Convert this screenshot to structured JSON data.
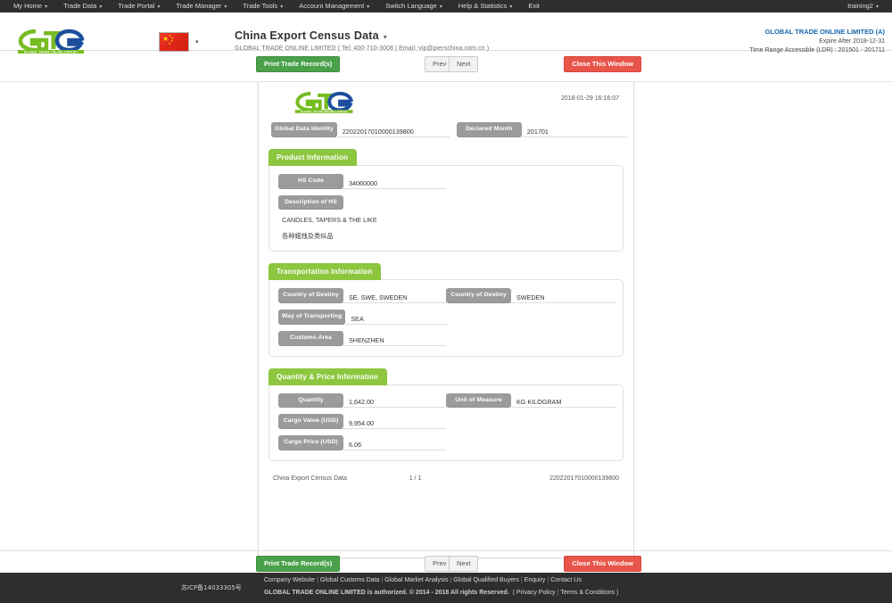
{
  "topnav": {
    "items": [
      {
        "label": "My Home",
        "caret": true
      },
      {
        "label": "Trade Data",
        "caret": true
      },
      {
        "label": "Trade Portal",
        "caret": true
      },
      {
        "label": "Trade Manager",
        "caret": true
      },
      {
        "label": "Trade Tools",
        "caret": true
      },
      {
        "label": "Account Management",
        "caret": true
      },
      {
        "label": "Switch Language",
        "caret": true
      },
      {
        "label": "Help & Statistics",
        "caret": true
      },
      {
        "label": "Exit",
        "caret": false
      }
    ],
    "user": "training2",
    "user_caret": "▾"
  },
  "header": {
    "logo_text": "GTO",
    "logo_tagline": "GLOBAL TRADE ONLINE LIMITED",
    "flag": "china-flag",
    "flag_caret": "▾",
    "title": "China Export Census Data",
    "title_caret": "▾",
    "subtitle": "GLOBAL TRADE ONLINE LIMITED ( Tel: 400-710-3008 | Email: vip@pierschina.com.cn )",
    "account_name": "GLOBAL TRADE ONLINE LIMITED (A)",
    "expire": "Expire After 2018-12-31",
    "time_range": "Time Range Accessible (LDR) : 201501 - 201711"
  },
  "toolbar": {
    "print_label": "Print Trade Record(s)",
    "prev_label": "Prev",
    "next_label": "Next",
    "close_label": "Close This Window"
  },
  "document": {
    "logo_text": "GTO",
    "logo_tagline": "GLOBAL TRADE ONLINE LIMITED",
    "timestamp": "2018-01-29 16:16:07",
    "identity_label": "Global Data Identity",
    "identity_value": "22022017010000139800",
    "declared_month_label": "Declared Month",
    "declared_month_value": "201701",
    "sections": [
      {
        "title": "Product Information",
        "fields": [
          {
            "label": "HS Code",
            "value": "34060000"
          },
          {
            "label": "Description of HS",
            "value": ""
          }
        ],
        "description_en": "CANDLES, TAPERS & THE LIKE",
        "description_cn": "各种蜡烛及类似品"
      },
      {
        "title": "Transportation Information",
        "rows": [
          {
            "label": "Country of Destiny",
            "value": "SE, SWE, SWEDEN",
            "label2": "Country of Destiny",
            "value2": "SWEDEN"
          },
          {
            "label": "Way of Transporting",
            "value": "SEA"
          },
          {
            "label": "Customs Area",
            "value": "SHENZHEN"
          }
        ]
      },
      {
        "title": "Quantity & Price Information",
        "rows": [
          {
            "label": "Quantity",
            "value": "1,642.00",
            "label2": "Unit of Measure",
            "value2": "KG KILOGRAM"
          },
          {
            "label": "Cargo Value (USD)",
            "value": "9,954.00"
          },
          {
            "label": "Cargo Price (USD)",
            "value": "6.06"
          }
        ]
      }
    ],
    "footer_left": "China Export Census Data",
    "footer_page": "1 / 1",
    "footer_right": "22022017010000139800"
  },
  "footer": {
    "icp": "苏ICP备14033305号",
    "links": [
      "Company Website",
      "Global Customs Data",
      "Global Market Analysis",
      "Global Qualified Buyers",
      "Enquiry",
      "Contact Us"
    ],
    "copyright": "GLOBAL TRADE ONLINE LIMITED is authorized. © 2014 - 2018 All rights Reserved.",
    "legal_open": "(",
    "legal": [
      "Privacy Policy",
      "Terms & Conditions"
    ],
    "legal_close": ")"
  },
  "colors": {
    "nav_bg": "#2e2e2e",
    "green_accent": "#8dc63f",
    "print_green": "#4aa14a",
    "close_red": "#e8554a",
    "label_gray": "#9b9b9b",
    "link_blue": "#1768b0"
  }
}
